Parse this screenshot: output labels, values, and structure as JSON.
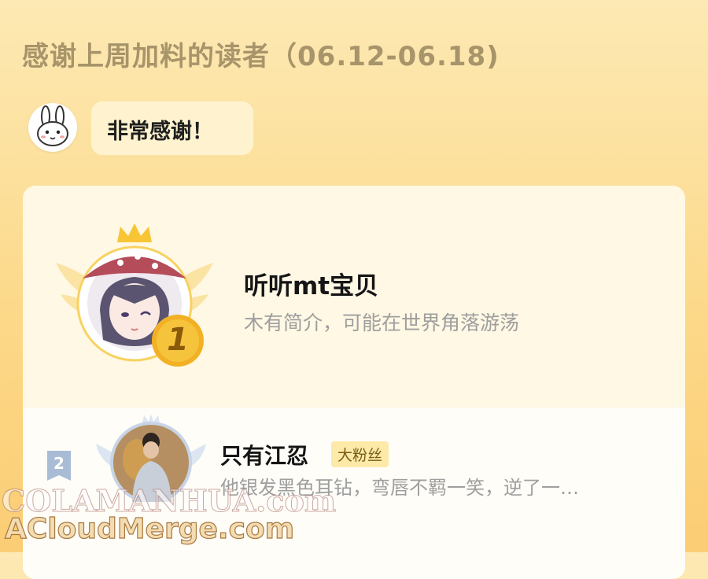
{
  "header": {
    "title": "感谢上周加料的读者（06.12-06.18)"
  },
  "thanks": {
    "message": "非常感谢！",
    "mascot_icon": "bunny-icon"
  },
  "leaderboard": {
    "first": {
      "rank": "1",
      "name": "听听mt宝贝",
      "bio": "木有简介，可能在世界角落游荡",
      "crown_color": "#f8c536"
    },
    "second": {
      "rank": "2",
      "name": "只有江忍",
      "tag": "大粉丝",
      "bio": "他银发黑色耳钻，弯唇不羁一笑，逆了一…"
    }
  },
  "watermarks": {
    "line1": "COLAMANHUA.com",
    "line2": "ACloudMerge.com"
  },
  "colors": {
    "accent": "#f8c536",
    "title": "#a7946a",
    "card": "#fff8e4"
  }
}
